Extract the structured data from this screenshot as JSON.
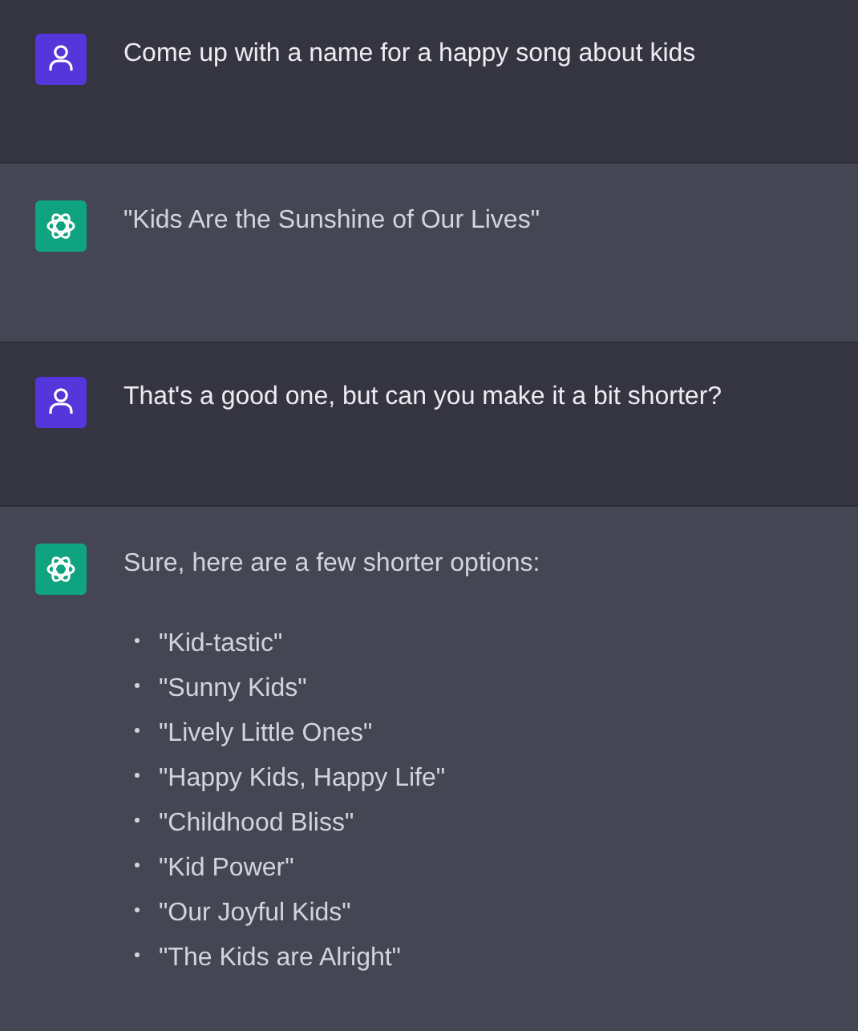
{
  "messages": [
    {
      "kind": "user",
      "text": "Come up with a name for a happy song about kids"
    },
    {
      "kind": "assistant",
      "text": "\"Kids Are the Sunshine of Our Lives\""
    },
    {
      "kind": "user",
      "text": "That's a good one, but can you make it a bit shorter?"
    },
    {
      "kind": "assistant",
      "text": "Sure, here are a few shorter options:",
      "list": [
        "\"Kid-tastic\"",
        "\"Sunny Kids\"",
        "\"Lively Little Ones\"",
        "\"Happy Kids, Happy Life\"",
        "\"Childhood Bliss\"",
        "\"Kid Power\"",
        "\"Our Joyful Kids\"",
        "\"The Kids are Alright\""
      ]
    }
  ]
}
